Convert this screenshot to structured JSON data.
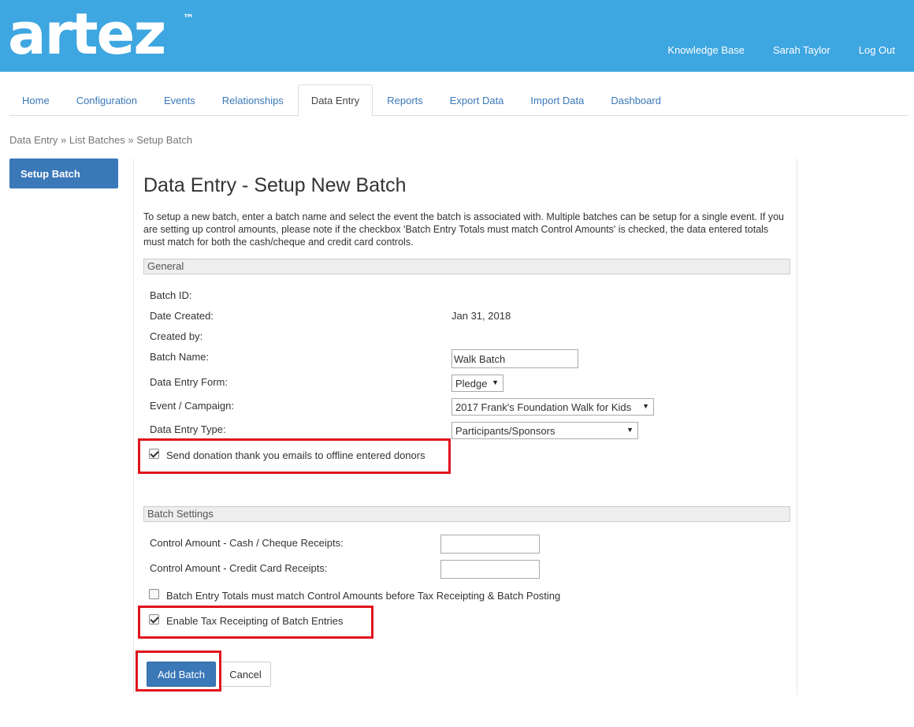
{
  "header": {
    "logo_text": "artez",
    "trademark": "™",
    "links": [
      "Knowledge Base",
      "Sarah Taylor",
      "Log Out"
    ]
  },
  "tabs": [
    {
      "label": "Home"
    },
    {
      "label": "Configuration"
    },
    {
      "label": "Events"
    },
    {
      "label": "Relationships"
    },
    {
      "label": "Data Entry",
      "active": true
    },
    {
      "label": "Reports"
    },
    {
      "label": "Export Data"
    },
    {
      "label": "Import Data"
    },
    {
      "label": "Dashboard"
    }
  ],
  "breadcrumb": {
    "items": [
      "Data Entry",
      "List Batches",
      "Setup Batch"
    ],
    "separator": "»"
  },
  "sidebar": {
    "active_label": "Setup Batch"
  },
  "page": {
    "title": "Data Entry - Setup New Batch",
    "intro": "To setup a new batch, enter a batch name and select the event the batch is associated with. Multiple batches can be setup for a single event. If you are setting up control amounts, please note if the checkbox 'Batch Entry Totals must match Control Amounts' is checked, the data entered totals must match for both the cash/cheque and credit card controls."
  },
  "general": {
    "section_title": "General",
    "batch_id_label": "Batch ID:",
    "batch_id_value": "",
    "date_created_label": "Date Created:",
    "date_created_value": "Jan 31, 2018",
    "created_by_label": "Created by:",
    "created_by_value": "",
    "batch_name_label": "Batch Name:",
    "batch_name_value": "Walk Batch",
    "form_label": "Data Entry Form:",
    "form_value": "Pledge",
    "event_label": "Event / Campaign:",
    "event_value": "2017 Frank's Foundation Walk for Kids",
    "type_label": "Data Entry Type:",
    "type_value": "Participants/Sponsors",
    "thank_you_label": "Send donation thank you emails to offline entered donors",
    "thank_you_checked": true
  },
  "batch_settings": {
    "section_title": "Batch Settings",
    "cash_label": "Control Amount - Cash / Cheque Receipts:",
    "cash_value": "",
    "credit_label": "Control Amount - Credit Card Receipts:",
    "credit_value": "",
    "match_label": "Batch Entry Totals must match Control Amounts before Tax Receipting & Batch Posting",
    "match_checked": false,
    "tax_label": "Enable Tax Receipting of Batch Entries",
    "tax_checked": true
  },
  "actions": {
    "add_label": "Add Batch",
    "cancel_label": "Cancel"
  },
  "colors": {
    "header_bg": "#3ea6e0",
    "primary": "#3a78b8",
    "highlight": "#e0141e"
  }
}
